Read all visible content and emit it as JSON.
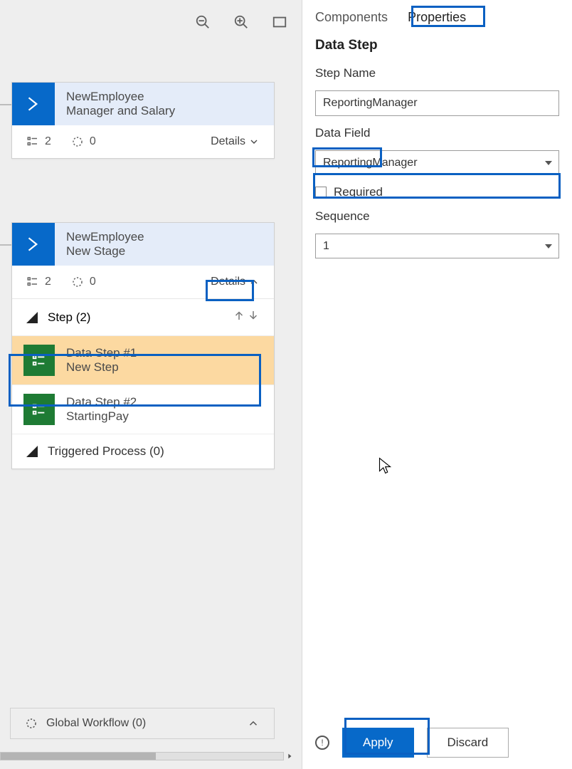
{
  "canvas": {
    "stages": [
      {
        "entity": "NewEmployee",
        "name": "Manager and Salary",
        "steps_count": "2",
        "process_count": "0",
        "details_label": "Details",
        "expanded": false
      },
      {
        "entity": "NewEmployee",
        "name": "New Stage",
        "steps_count": "2",
        "process_count": "0",
        "details_label": "Details",
        "expanded": true,
        "step_header": "Step (2)",
        "data_steps": [
          {
            "title": "Data Step #1",
            "sub": "New Step",
            "selected": true
          },
          {
            "title": "Data Step #2",
            "sub": "StartingPay",
            "selected": false
          }
        ],
        "triggered_label": "Triggered Process (0)"
      }
    ],
    "global_workflow_label": "Global Workflow (0)"
  },
  "props": {
    "tabs": {
      "components": "Components",
      "properties": "Properties",
      "active": "properties"
    },
    "section": "Data Step",
    "step_name_label": "Step Name",
    "step_name_value": "ReportingManager",
    "data_field_label": "Data Field",
    "data_field_value": "ReportingManager",
    "required_label": "Required",
    "required_checked": false,
    "sequence_label": "Sequence",
    "sequence_value": "1",
    "apply_label": "Apply",
    "discard_label": "Discard"
  }
}
